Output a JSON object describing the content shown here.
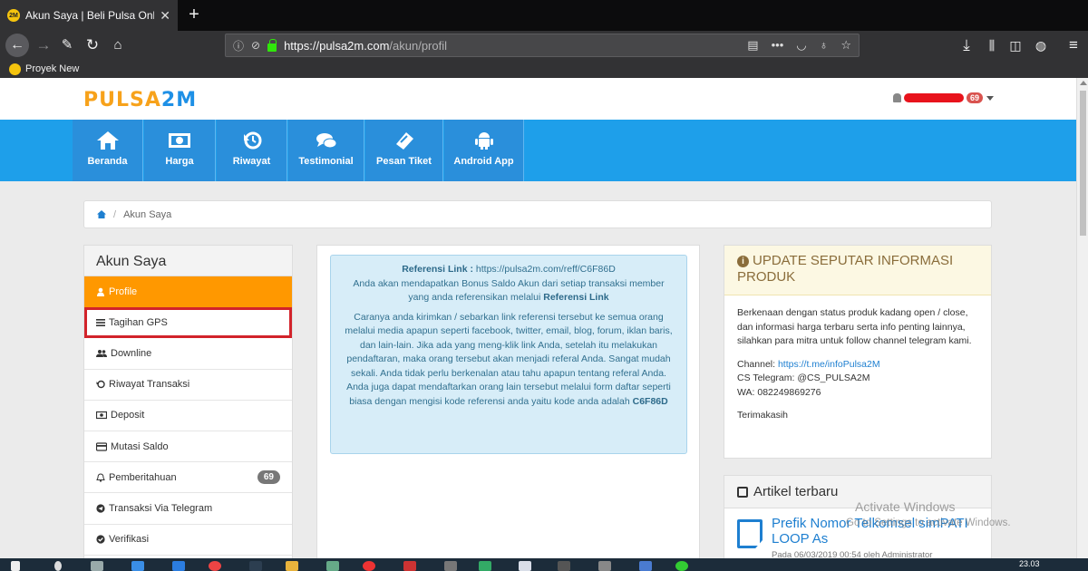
{
  "browser": {
    "tab_title": "Akun Saya | Beli Pulsa Online T...",
    "url_host": "https://pulsa2m.com",
    "url_path": "/akun/profil",
    "bookmark": "Proyek New"
  },
  "site": {
    "logo_a": "PULSA",
    "logo_b": "2M",
    "user_badge": "69",
    "menu": [
      {
        "label": "Beranda",
        "icon": "home-icon"
      },
      {
        "label": "Harga",
        "icon": "money-icon"
      },
      {
        "label": "Riwayat",
        "icon": "history-icon"
      },
      {
        "label": "Testimonial",
        "icon": "comments-icon"
      },
      {
        "label": "Pesan Tiket",
        "icon": "ticket-icon"
      },
      {
        "label": "Android App",
        "icon": "android-icon"
      }
    ],
    "breadcrumb": "Akun Saya"
  },
  "sidebar": {
    "title": "Akun Saya",
    "items": [
      {
        "label": "Profile",
        "icon": "user-icon"
      },
      {
        "label": "Tagihan GPS",
        "icon": "bars-icon"
      },
      {
        "label": "Downline",
        "icon": "users-icon"
      },
      {
        "label": "Riwayat Transaksi",
        "icon": "history-icon"
      },
      {
        "label": "Deposit",
        "icon": "money-icon"
      },
      {
        "label": "Mutasi Saldo",
        "icon": "card-icon"
      },
      {
        "label": "Pemberitahuan",
        "icon": "bell-icon",
        "badge": "69"
      },
      {
        "label": "Transaksi Via Telegram",
        "icon": "telegram-icon"
      },
      {
        "label": "Verifikasi",
        "icon": "check-icon"
      }
    ]
  },
  "referral": {
    "label": "Referensi Link :",
    "link": "https://pulsa2m.com/reff/C6F86D",
    "line1": "Anda akan mendapatkan Bonus Saldo Akun dari setiap transaksi member yang anda referensikan melalui",
    "line1_bold": "Referensi Link",
    "para2": "Caranya anda kirimkan / sebarkan link referensi tersebut ke semua orang melalui media apapun seperti facebook, twitter, email, blog, forum, iklan baris, dan lain-lain. Jika ada yang meng-klik link Anda, setelah itu melakukan pendaftaran, maka orang tersebut akan menjadi referal Anda. Sangat mudah sekali. Anda tidak perlu berkenalan atau tahu apapun tentang referal Anda.",
    "para3": "Anda juga dapat mendaftarkan orang lain tersebut melalui form daftar seperti biasa dengan mengisi kode referensi anda yaitu kode anda adalah",
    "code": "C6F86D"
  },
  "info": {
    "title": "UPDATE SEPUTAR INFORMASI PRODUK",
    "body": "Berkenaan dengan status produk kadang open / close, dan informasi harga terbaru serta info penting lainnya, silahkan para mitra untuk follow channel telegram kami.",
    "channel_label": "Channel:",
    "channel_link": "https://t.me/infoPulsa2M",
    "cs": "CS Telegram: @CS_PULSA2M",
    "wa": "WA: 082249869276",
    "thanks": "Terimakasih"
  },
  "articles": {
    "title": "Artikel terbaru",
    "item_title": "Prefik Nomor Telkomsel simPATI LOOP As",
    "item_meta": "Pada 06/03/2019 00:54 oleh Administrator"
  },
  "watermark": {
    "line1": "Activate Windows",
    "line2": "Go to Settings to activate Windows."
  },
  "taskbar": {
    "time": "23.03"
  }
}
